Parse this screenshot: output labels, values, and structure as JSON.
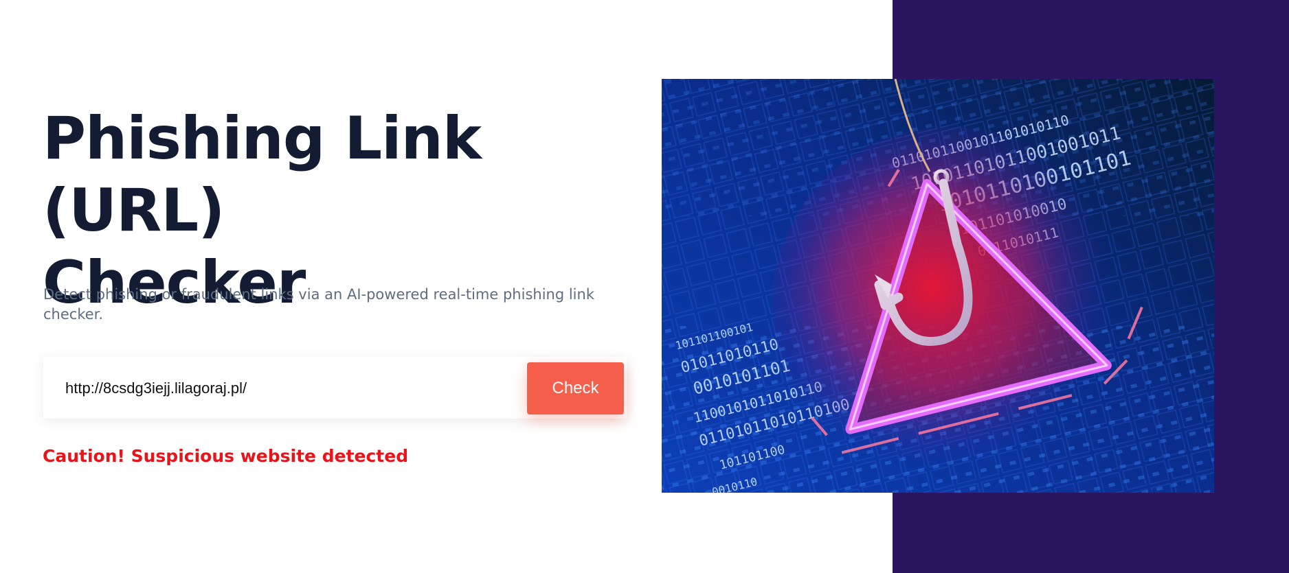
{
  "hero": {
    "title_line1": "Phishing Link (URL)",
    "title_line2": "Checker",
    "subtitle": "Detect phishing or fraudulent links via an AI-powered real-time phishing link checker."
  },
  "checker": {
    "url_value": "http://8csdg3iejj.lilagoraj.pl/",
    "button_label": "Check",
    "result_text": "Caution! Suspicious website detected"
  },
  "illustration": {
    "icon": "phishing-hook-warning-icon",
    "binary_rows": [
      "0110101100101101010110",
      "10101101011001001011",
      "1010110100101101",
      "0101101010010",
      "0011010111",
      "101101100101",
      "01011010110",
      "0010101101",
      "1100101011010110",
      "01101011010110100",
      "101101100",
      "0010110"
    ]
  },
  "colors": {
    "title": "#131c33",
    "subtitle": "#5e6d82",
    "button": "#f55f4b",
    "alert": "#e8141a",
    "panel": "#2a1660"
  }
}
